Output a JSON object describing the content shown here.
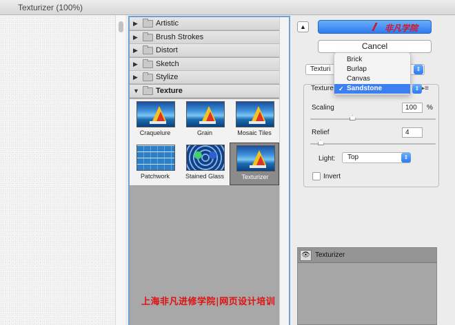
{
  "window": {
    "title": "Texturizer (100%)"
  },
  "gallery": {
    "categories": [
      {
        "label": "Artistic"
      },
      {
        "label": "Brush Strokes"
      },
      {
        "label": "Distort"
      },
      {
        "label": "Sketch"
      },
      {
        "label": "Stylize"
      },
      {
        "label": "Texture"
      }
    ],
    "texture_filters": [
      "Craquelure",
      "Grain",
      "Mosaic Tiles",
      "Patchwork",
      "Stained Glass",
      "Texturizer"
    ],
    "selected_filter": "Texturizer"
  },
  "buttons": {
    "ok_logo_text": "非凡学院",
    "cancel": "Cancel"
  },
  "filter_select": {
    "value": "Texturi"
  },
  "settings": {
    "texture_label": "Texture",
    "texture_options": [
      "Brick",
      "Burlap",
      "Canvas",
      "Sandstone"
    ],
    "texture_selected": "Sandstone",
    "scaling_label": "Scaling",
    "scaling_value": "100",
    "scaling_unit": "%",
    "scaling_fraction": 0.333,
    "relief_label": "Relief",
    "relief_value": "4",
    "relief_fraction": 0.08,
    "light_label": "Light:",
    "light_value": "Top",
    "invert_label": "Invert",
    "invert_checked": false
  },
  "layers": {
    "items": [
      {
        "label": "Texturizer"
      }
    ]
  },
  "watermark": {
    "text": "上海非凡进修学院|网页设计培训"
  },
  "colors": {
    "accent": "#2d7bf0",
    "selection": "#3b7ff0",
    "watermark": "#e01010"
  }
}
